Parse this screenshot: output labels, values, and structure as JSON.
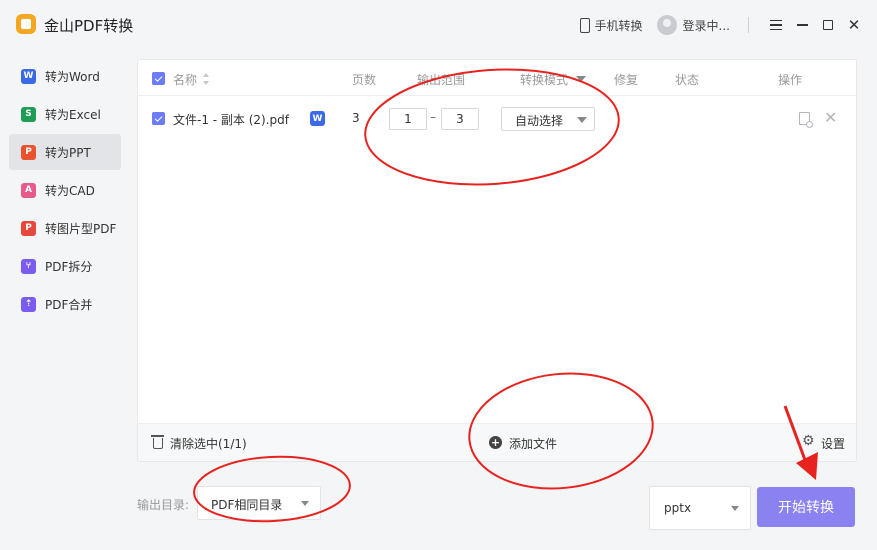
{
  "app": {
    "title": "金山PDF转换"
  },
  "titlebar": {
    "phone_convert": "手机转换",
    "login": "登录中..."
  },
  "sidebar": {
    "items": [
      {
        "label": "转为Word",
        "icon": "W",
        "color": "#3b6ae8"
      },
      {
        "label": "转为Excel",
        "icon": "S",
        "color": "#1f9d55"
      },
      {
        "label": "转为PPT",
        "icon": "P",
        "color": "#e8522f",
        "active": true
      },
      {
        "label": "转为CAD",
        "icon": "A",
        "color": "#e85a8a"
      },
      {
        "label": "转图片型PDF",
        "icon": "P",
        "color": "#e8473b"
      },
      {
        "label": "PDF拆分",
        "icon": "⑂",
        "color": "#7b5cf0"
      },
      {
        "label": "PDF合并",
        "icon": "⇡",
        "color": "#7b5cf0"
      }
    ]
  },
  "table": {
    "headers": {
      "name": "名称",
      "pages": "页数",
      "range": "输出范围",
      "mode": "转换模式",
      "repair": "修复",
      "status": "状态",
      "action": "操作"
    },
    "rows": [
      {
        "filename": "文件-1 - 副本 (2).pdf",
        "badge": "W",
        "pages": "3",
        "range_from": "1",
        "range_to": "3",
        "mode": "自动选择"
      }
    ]
  },
  "footer": {
    "clear": "清除选中(1/1)",
    "add_file": "添加文件",
    "settings": "设置"
  },
  "output": {
    "label": "输出目录:",
    "dir": "PDF相同目录"
  },
  "format": {
    "value": "pptx"
  },
  "start_button": "开始转换",
  "colors": {
    "accent": "#6b7cf6",
    "start_button": "#8a82f0",
    "annotation": "#e8231f"
  }
}
